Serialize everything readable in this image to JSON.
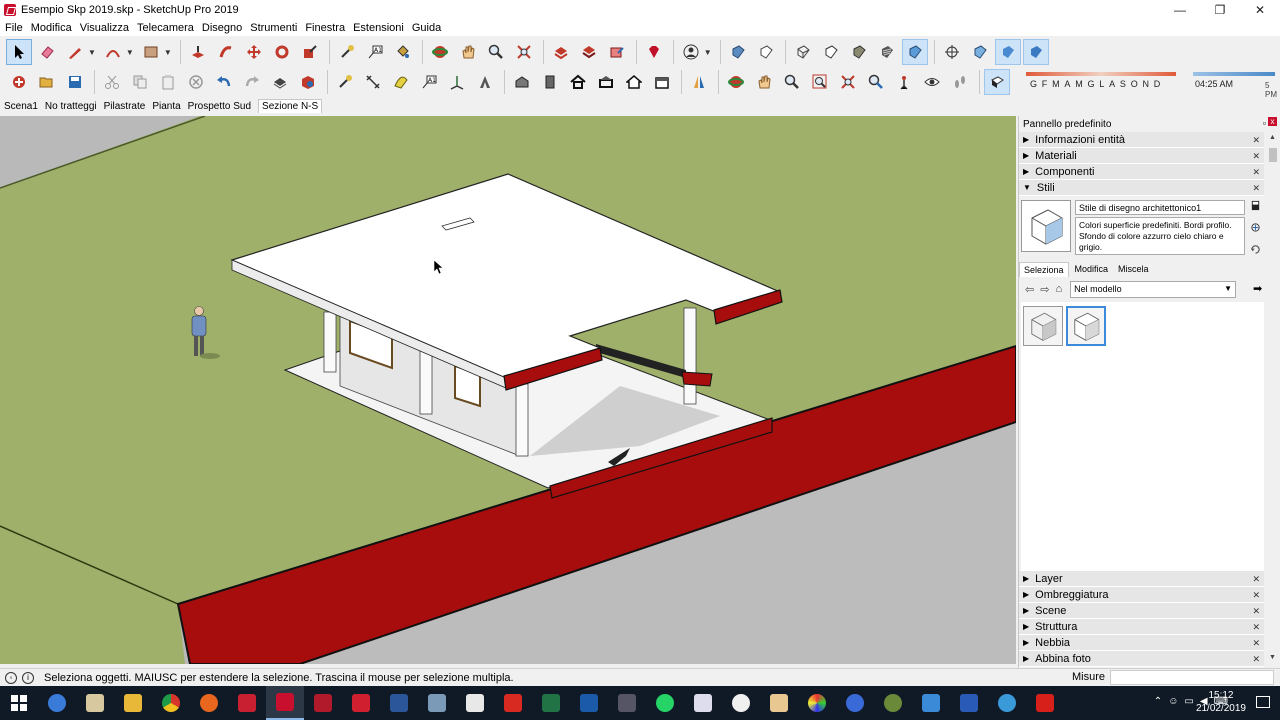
{
  "window": {
    "title": "Esempio Skp 2019.skp - SketchUp Pro 2019",
    "minimize": "—",
    "maximize": "❐",
    "close": "✕"
  },
  "menu": [
    "File",
    "Modifica",
    "Visualizza",
    "Telecamera",
    "Disegno",
    "Strumenti",
    "Finestra",
    "Estensioni",
    "Guida"
  ],
  "shadow": {
    "months": "GFMAMGLASOND",
    "time": "04:25 AM",
    "time_end": "5 PM"
  },
  "scenes": [
    "Scena1",
    "No tratteggi",
    "Pilastrate",
    "Pianta",
    "Prospetto Sud",
    "Sezione N-S"
  ],
  "tray": {
    "title": "Pannello predefinito",
    "pin": "▫",
    "close": "x",
    "panels_top": [
      "Informazioni entità",
      "Materiali",
      "Componenti",
      "Stili"
    ],
    "style_name": "Stile di disegno architettonico1",
    "style_desc": "Colori superficie predefiniti. Bordi profilo. Sfondo di colore azzurro cielo chiaro e grigio.",
    "subtabs": [
      "Seleziona",
      "Modifica",
      "Miscela"
    ],
    "selector": "Nel modello",
    "panels_bottom": [
      "Layer",
      "Ombreggiatura",
      "Scene",
      "Struttura",
      "Nebbia",
      "Abbina foto"
    ]
  },
  "status": {
    "text": "Seleziona oggetti. MAIUSC per estendere la selezione. Trascina il mouse per selezione multipla.",
    "measure_label": "Misure",
    "measure_value": ""
  },
  "taskbar": {
    "time": "15:12",
    "date": "21/02/2019"
  },
  "colors": {
    "grass": "#9fb06a",
    "section_red": "#a80d0d",
    "road": "#bcbcbc",
    "accent": "#3c8ad8"
  }
}
